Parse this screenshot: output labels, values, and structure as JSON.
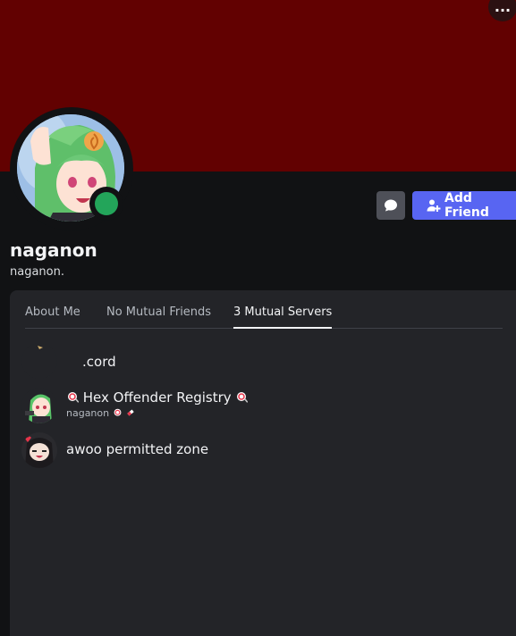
{
  "banner": {
    "color": "#620101"
  },
  "header": {
    "more_label": "···"
  },
  "profile": {
    "display_name": "naganon",
    "username": "naganon.",
    "status": "online",
    "status_color": "#23a55a"
  },
  "actions": {
    "message_icon": "message-icon",
    "add_friend_label": "Add Friend",
    "add_friend_icon": "add-friend-icon",
    "accent": "#5865f2"
  },
  "tabs": [
    {
      "label": "About Me",
      "active": false
    },
    {
      "label": "No Mutual Friends",
      "active": false
    },
    {
      "label": "3 Mutual Servers",
      "active": true
    }
  ],
  "servers": [
    {
      "name": ".cord",
      "nickname": ""
    },
    {
      "name": "Hex Offender Registry",
      "nickname": "naganon"
    },
    {
      "name": "awoo permitted zone",
      "nickname": ""
    }
  ]
}
